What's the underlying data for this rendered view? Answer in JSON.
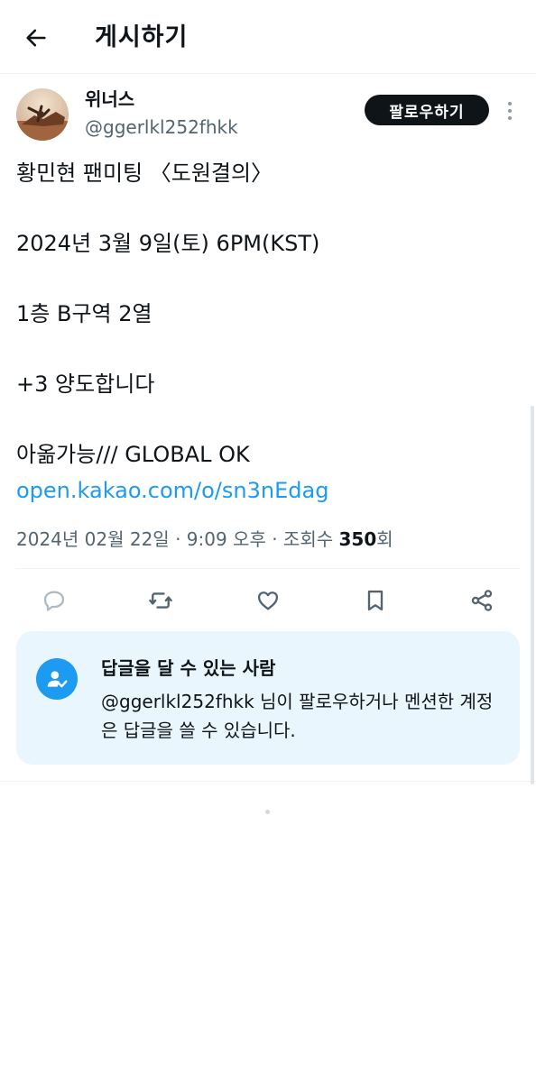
{
  "header": {
    "title": "게시하기"
  },
  "author": {
    "display_name": "위너스",
    "handle": "@ggerlkl252fhkk",
    "follow_label": "팔로우하기"
  },
  "post": {
    "lines": [
      "황민현 팬미팅 〈도원결의〉",
      "2024년 3월 9일(토) 6PM(KST)",
      "1층 B구역 2열",
      "+3 양도합니다",
      "아옮가능/// GLOBAL OK"
    ],
    "link": "open.kakao.com/o/sn3nEdag"
  },
  "meta": {
    "datetime": "2024년 02월 22일 · 9:09 오후 · 조회수 ",
    "views": "350",
    "views_suffix": "회"
  },
  "actions": {
    "reply_icon": "reply-icon",
    "repost_icon": "repost-icon",
    "like_icon": "heart-icon",
    "bookmark_icon": "bookmark-icon",
    "share_icon": "share-icon"
  },
  "reply_restriction": {
    "title": "답글을 달 수 있는 사람",
    "description": "@ggerlkl252fhkk 님이 팔로우하거나 멘션한 계정은 답글을 쓸 수 있습니다."
  },
  "colors": {
    "accent": "#1d9bf0",
    "text": "#0f1419",
    "muted": "#536471",
    "reply_box_bg": "#eaf6fd"
  }
}
